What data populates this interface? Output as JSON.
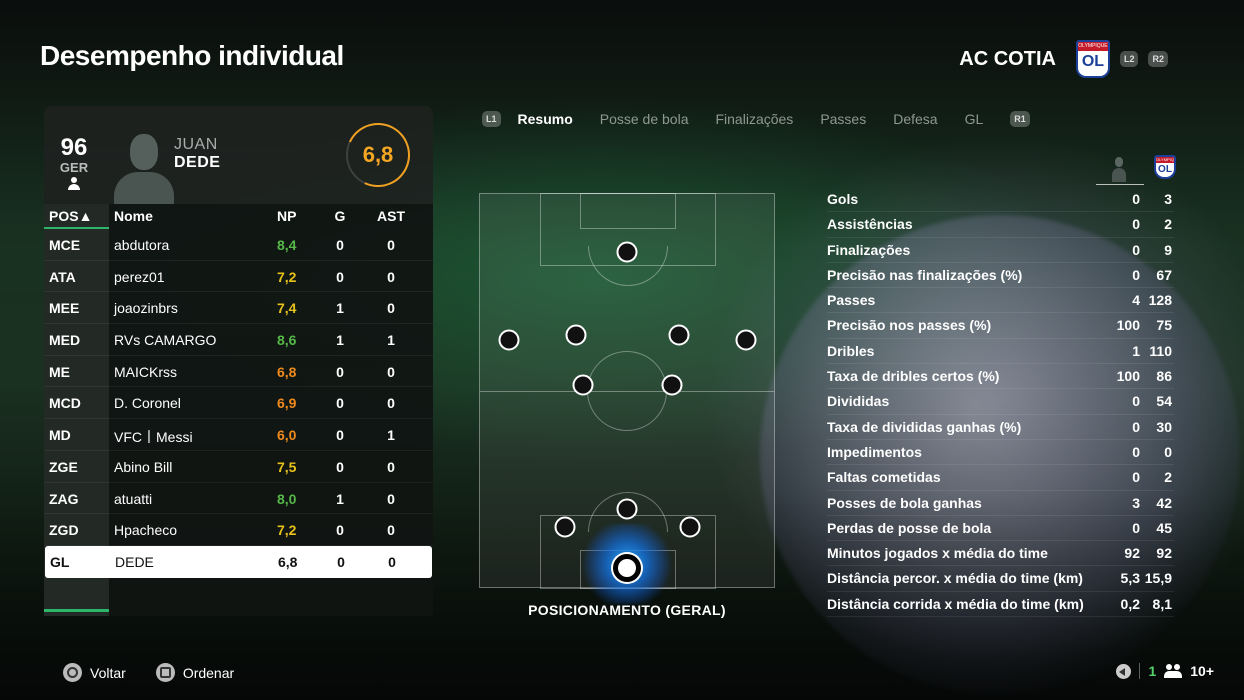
{
  "page_title": "Desempenho individual",
  "team": {
    "name": "AC COTIA",
    "crest_top": "OLYMPIQUE LYONNAIS",
    "crest_mono": "OL",
    "l2": "L2",
    "r2": "R2"
  },
  "player": {
    "overall": "96",
    "position": "GER",
    "first_name": "JUAN",
    "last_name": "DEDE",
    "rating": "6,8"
  },
  "table": {
    "headers": {
      "pos": "POS▲",
      "name": "Nome",
      "np": "NP",
      "g": "G",
      "ast": "AST"
    },
    "rows": [
      {
        "pos": "MCE",
        "name": "abdutora",
        "np": "8,4",
        "np_color": "green",
        "g": "0",
        "ast": "0"
      },
      {
        "pos": "ATA",
        "name": "perez01",
        "np": "7,2",
        "np_color": "yellow",
        "g": "0",
        "ast": "0"
      },
      {
        "pos": "MEE",
        "name": "joaozinbrs",
        "np": "7,4",
        "np_color": "yellow",
        "g": "1",
        "ast": "0"
      },
      {
        "pos": "MED",
        "name": "RVs CAMARGO",
        "np": "8,6",
        "np_color": "green",
        "g": "1",
        "ast": "1"
      },
      {
        "pos": "ME",
        "name": "MAICKrss",
        "np": "6,8",
        "np_color": "orange",
        "g": "0",
        "ast": "0"
      },
      {
        "pos": "MCD",
        "name": "D. Coronel",
        "np": "6,9",
        "np_color": "orange",
        "g": "0",
        "ast": "0"
      },
      {
        "pos": "MD",
        "name": "VFC丨Messi",
        "np": "6,0",
        "np_color": "orange",
        "g": "0",
        "ast": "1"
      },
      {
        "pos": "ZGE",
        "name": "Abino Bill",
        "np": "7,5",
        "np_color": "yellow",
        "g": "0",
        "ast": "0"
      },
      {
        "pos": "ZAG",
        "name": "atuatti",
        "np": "8,0",
        "np_color": "green",
        "g": "1",
        "ast": "0"
      },
      {
        "pos": "ZGD",
        "name": "Hpacheco",
        "np": "7,2",
        "np_color": "yellow",
        "g": "0",
        "ast": "0"
      },
      {
        "pos": "GL",
        "name": "DEDE",
        "np": "6,8",
        "np_color": "white",
        "g": "0",
        "ast": "0",
        "selected": true
      }
    ]
  },
  "tabs": {
    "l1": "L1",
    "r1": "R1",
    "items": [
      "Resumo",
      "Posse de bola",
      "Finalizações",
      "Passes",
      "Defesa",
      "GL"
    ],
    "active": "Resumo"
  },
  "pitch_caption": "POSICIONAMENTO (GERAL)",
  "stats": [
    {
      "label": "Gols",
      "player": "0",
      "team": "3"
    },
    {
      "label": "Assistências",
      "player": "0",
      "team": "2"
    },
    {
      "label": "Finalizações",
      "player": "0",
      "team": "9"
    },
    {
      "label": "Precisão nas finalizações (%)",
      "player": "0",
      "team": "67"
    },
    {
      "label": "Passes",
      "player": "4",
      "team": "128"
    },
    {
      "label": "Precisão nos passes (%)",
      "player": "100",
      "team": "75"
    },
    {
      "label": "Dribles",
      "player": "1",
      "team": "110"
    },
    {
      "label": "Taxa de dribles certos (%)",
      "player": "100",
      "team": "86"
    },
    {
      "label": "Divididas",
      "player": "0",
      "team": "54"
    },
    {
      "label": "Taxa de divididas ganhas (%)",
      "player": "0",
      "team": "30"
    },
    {
      "label": "Impedimentos",
      "player": "0",
      "team": "0"
    },
    {
      "label": "Faltas cometidas",
      "player": "0",
      "team": "2"
    },
    {
      "label": "Posses de bola ganhas",
      "player": "3",
      "team": "42"
    },
    {
      "label": "Perdas de posse de bola",
      "player": "0",
      "team": "45"
    },
    {
      "label": "Minutos jogados x média do time",
      "player": "92",
      "team": "92"
    },
    {
      "label": "Distância percor. x média do time (km)",
      "player": "5,3",
      "team": "15,9"
    },
    {
      "label": "Distância corrida x média do time (km)",
      "player": "0,2",
      "team": "8,1"
    }
  ],
  "footer": {
    "back": "Voltar",
    "sort": "Ordenar",
    "online": "1",
    "players": "10+"
  }
}
